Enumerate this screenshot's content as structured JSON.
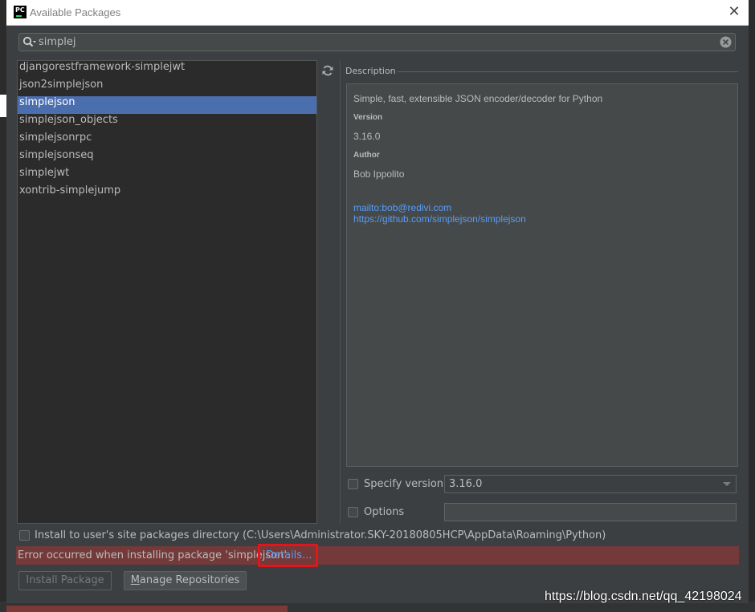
{
  "window": {
    "title": "Available Packages",
    "app_icon_text": "PC"
  },
  "search": {
    "value": "simplej"
  },
  "packages": [
    "djangorestframework-simplejwt",
    "json2simplejson",
    "simplejson",
    "simplejson_objects",
    "simplejsonrpc",
    "simplejsonseq",
    "simplejwt",
    "xontrib-simplejump"
  ],
  "selected_index": 2,
  "description": {
    "label": "Description",
    "summary": "Simple, fast, extensible JSON encoder/decoder for Python",
    "version_label": "Version",
    "version": "3.16.0",
    "author_label": "Author",
    "author": "Bob Ippolito",
    "email_link": "mailto:bob@redivi.com",
    "home_link": "https://github.com/simplejson/simplejson"
  },
  "specify_version": {
    "label": "Specify version",
    "value": "3.16.0"
  },
  "options": {
    "label": "Options",
    "value": ""
  },
  "install_user": {
    "label": "Install to user's site packages directory (C:\\Users\\Administrator.SKY-20180805HCP\\AppData\\Roaming\\Python)"
  },
  "error": {
    "message": "Error occurred when installing package 'simplejson'.",
    "details_link": "Details..."
  },
  "buttons": {
    "install": "Install Package",
    "manage_prefix": "M",
    "manage_rest": "anage Repositories"
  },
  "watermark": "https://blog.csdn.net/qq_42198024",
  "colors": {
    "selection": "#4b6eaf",
    "error_bg": "#743a3a",
    "link": "#589df6",
    "highlight_box": "#e0161c"
  }
}
